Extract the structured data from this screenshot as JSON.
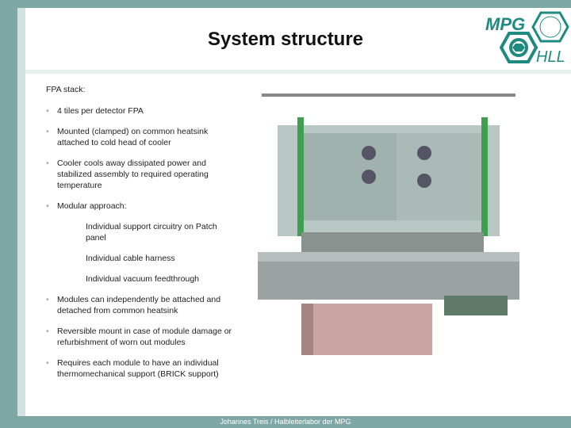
{
  "title": "System structure",
  "logo": {
    "text": "MPG HLL"
  },
  "heading": "FPA stack:",
  "bullets": [
    "4 tiles per detector FPA",
    "Mounted (clamped) on common heatsink attached to cold head of cooler",
    "Cooler cools away dissipated power and stabilized assembly to required operating temperature",
    "Modular approach:"
  ],
  "sub_bullets": [
    "Individual support circuitry on Patch panel",
    "Individual cable harness",
    "Individual vacuum feedthrough"
  ],
  "bullets2": [
    "Modules can independently be attached and detached from common heatsink",
    "Reversible mount in case of module damage or refurbishment of worn out modules",
    "Requires each module to have an individual thermomechanical support (BRICK support)"
  ],
  "footer": "Johannes Treis / Halbleiterlabor der MPG",
  "colors": {
    "frame": "#7fa7a5",
    "logo": "#1f8a80"
  }
}
